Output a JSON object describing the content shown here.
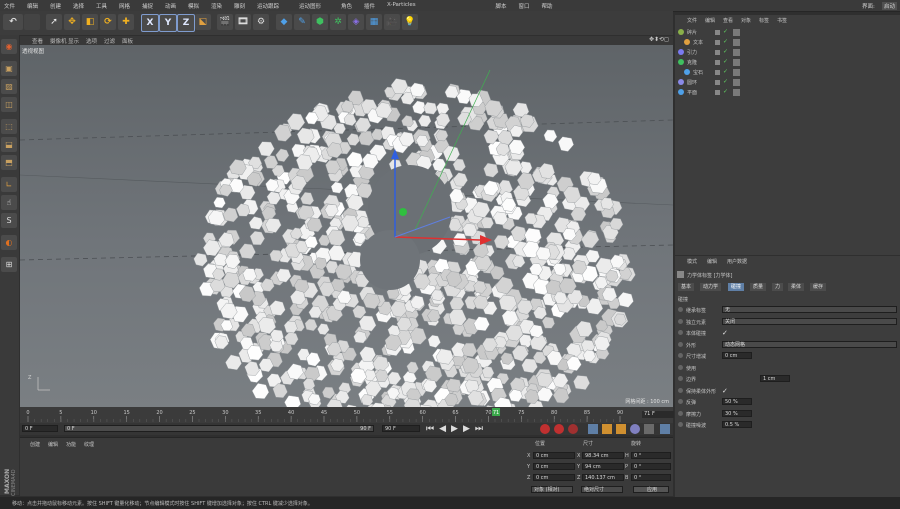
{
  "menubar": {
    "left": [
      "文件",
      "编辑",
      "创建",
      "选择",
      "工具",
      "网格",
      "捕捉",
      "动画",
      "模拟",
      "渲染",
      "雕刻",
      "运动跟踪",
      "运动图形",
      "角色",
      "插件",
      "X-Particles",
      "脚本",
      "窗口",
      "帮助"
    ],
    "right": [
      "界面:",
      "启动"
    ]
  },
  "viewport": {
    "menu": [
      "查看",
      "摄像机",
      "显示",
      "选项",
      "过滤",
      "面板"
    ],
    "label": "透视视图",
    "grid_label": "网格间距 : 100 cm"
  },
  "timeline": {
    "ticks": [
      "0",
      "5",
      "10",
      "15",
      "20",
      "25",
      "30",
      "35",
      "40",
      "45",
      "50",
      "55",
      "60",
      "65",
      "70",
      "75",
      "80",
      "85",
      "90"
    ],
    "current": "71",
    "end_frame": "71 F"
  },
  "playback": {
    "start": "0 F",
    "min": "0 F",
    "max": "90 F",
    "end": "90 F"
  },
  "material_manager": {
    "menu": [
      "创建",
      "编辑",
      "功能",
      "纹理"
    ]
  },
  "coordinates": {
    "headers": [
      "位置",
      "尺寸",
      "旋转"
    ],
    "rows": [
      {
        "axis": "X",
        "pos": "0 cm",
        "size": "98.34 cm",
        "rot_axis": "H",
        "rot": "0 °"
      },
      {
        "axis": "Y",
        "pos": "0 cm",
        "size": "94 cm",
        "rot_axis": "P",
        "rot": "0 °"
      },
      {
        "axis": "Z",
        "pos": "0 cm",
        "size": "140.137 cm",
        "rot_axis": "B",
        "rot": "0 °"
      }
    ],
    "mode": "对象 (相对)",
    "size_mode": "绝对尺寸",
    "apply": "应用"
  },
  "object_manager": {
    "menu": [
      "文件",
      "编辑",
      "查看",
      "对象",
      "标签",
      "书签"
    ],
    "objects": [
      {
        "name": "碎片",
        "indent": 0
      },
      {
        "name": "文本",
        "indent": 1
      },
      {
        "name": "引力",
        "indent": 0
      },
      {
        "name": "克隆",
        "indent": 0
      },
      {
        "name": "宝石",
        "indent": 1
      },
      {
        "name": "圆环",
        "indent": 0
      },
      {
        "name": "平面",
        "indent": 0
      }
    ]
  },
  "attribute_manager": {
    "menu": [
      "模式",
      "编辑",
      "用户数据"
    ],
    "title": "力学体标签 [力学体]",
    "tabs": [
      "基本",
      "动力学",
      "碰撞",
      "质量",
      "力",
      "柔体",
      "缓存"
    ],
    "active_tab": "碰撞",
    "section": "碰撞",
    "props": [
      {
        "label": "继承标签",
        "value": "无",
        "type": "dropdown"
      },
      {
        "label": "独立元素",
        "value": "关闭",
        "type": "dropdown"
      },
      {
        "label": "本体碰撞",
        "value": "✓",
        "type": "check"
      },
      {
        "label": "外形",
        "value": "动态网格",
        "type": "dropdown"
      },
      {
        "label": "尺寸增减",
        "value": "0 cm",
        "type": "field"
      },
      {
        "label": "使用",
        "value": "",
        "type": "check"
      },
      {
        "label": "边界",
        "value": "1 cm",
        "type": "field"
      },
      {
        "label": "保持柔体外形",
        "value": "✓",
        "type": "check"
      },
      {
        "label": "反弹",
        "value": "50 %",
        "type": "field"
      },
      {
        "label": "摩擦力",
        "value": "30 %",
        "type": "field"
      },
      {
        "label": "碰撞噪波",
        "value": "0.5 %",
        "type": "field"
      }
    ]
  },
  "status": {
    "text": "移动：点击并拖动鼠标移动元素。按住 SHIFT 键量化移动；节点编辑模式时按住 SHIFT 键增加选择对象；按住 CTRL 键减少选择对象。"
  },
  "branding": {
    "line1": "MAXON",
    "line2": "CINEMA4D"
  },
  "colors": {
    "accent": "#5f7fa6",
    "x_axis": "#e03030",
    "y_axis": "#2fbf3f",
    "z_axis": "#2f5fe0"
  }
}
